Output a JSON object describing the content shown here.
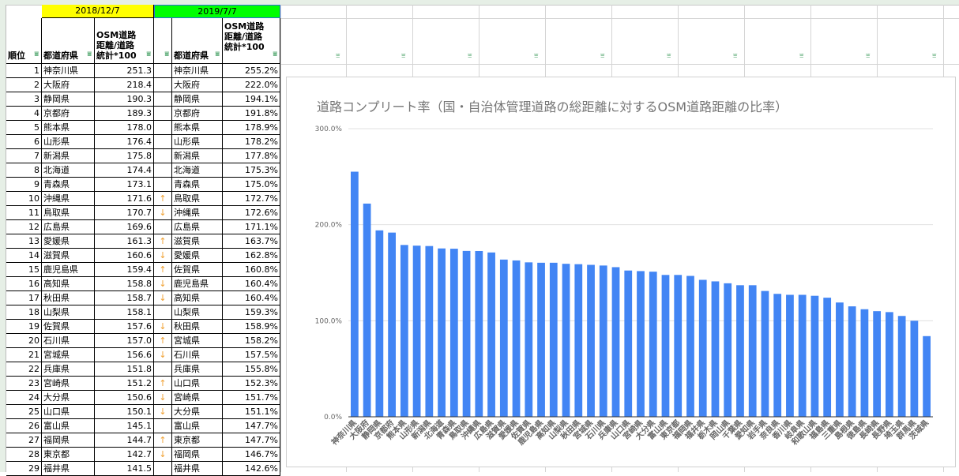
{
  "dates": {
    "d2018": "2018/12/7",
    "d2019": "2019/7/7"
  },
  "headers": {
    "rank": "順位",
    "pref": "都道府県",
    "ratio2018": "OSM道路距離/道路統計*100",
    "pref2019": "都道府県",
    "ratio2019": "OSM道路距離/道路統計*100"
  },
  "colors": {
    "d2018": "#ffff00",
    "d2019": "#00ff00",
    "bar": "#4285f4",
    "arrow": "#f0a030"
  },
  "rows": [
    [
      "1",
      "神奈川県",
      "251.3",
      "",
      "神奈川県",
      "255.2%"
    ],
    [
      "2",
      "大阪府",
      "218.4",
      "",
      "大阪府",
      "222.0%"
    ],
    [
      "3",
      "静岡県",
      "190.3",
      "",
      "静岡県",
      "194.1%"
    ],
    [
      "4",
      "京都府",
      "189.3",
      "",
      "京都府",
      "191.8%"
    ],
    [
      "5",
      "熊本県",
      "178.0",
      "",
      "熊本県",
      "178.9%"
    ],
    [
      "6",
      "山形県",
      "176.4",
      "",
      "山形県",
      "178.2%"
    ],
    [
      "7",
      "新潟県",
      "175.8",
      "",
      "新潟県",
      "177.8%"
    ],
    [
      "8",
      "北海道",
      "174.4",
      "",
      "北海道",
      "175.3%"
    ],
    [
      "9",
      "青森県",
      "173.1",
      "",
      "青森県",
      "175.0%"
    ],
    [
      "10",
      "沖縄県",
      "171.6",
      "↑",
      "鳥取県",
      "172.7%"
    ],
    [
      "11",
      "鳥取県",
      "170.7",
      "↓",
      "沖縄県",
      "172.6%"
    ],
    [
      "12",
      "広島県",
      "169.6",
      "",
      "広島県",
      "171.1%"
    ],
    [
      "13",
      "愛媛県",
      "161.3",
      "↑",
      "滋賀県",
      "163.7%"
    ],
    [
      "14",
      "滋賀県",
      "160.6",
      "↓",
      "愛媛県",
      "162.8%"
    ],
    [
      "15",
      "鹿児島県",
      "159.4",
      "↑",
      "佐賀県",
      "160.8%"
    ],
    [
      "16",
      "高知県",
      "158.8",
      "↓",
      "鹿児島県",
      "160.4%"
    ],
    [
      "17",
      "秋田県",
      "158.7",
      "↓",
      "高知県",
      "160.4%"
    ],
    [
      "18",
      "山梨県",
      "158.1",
      "",
      "山梨県",
      "159.3%"
    ],
    [
      "19",
      "佐賀県",
      "157.6",
      "↓",
      "秋田県",
      "158.9%"
    ],
    [
      "20",
      "石川県",
      "157.0",
      "↑",
      "宮城県",
      "158.2%"
    ],
    [
      "21",
      "宮城県",
      "156.6",
      "↓",
      "石川県",
      "157.5%"
    ],
    [
      "22",
      "兵庫県",
      "151.8",
      "",
      "兵庫県",
      "155.8%"
    ],
    [
      "23",
      "宮崎県",
      "151.2",
      "↑",
      "山口県",
      "152.3%"
    ],
    [
      "24",
      "大分県",
      "150.6",
      "↓",
      "宮崎県",
      "151.7%"
    ],
    [
      "25",
      "山口県",
      "150.1",
      "↓",
      "大分県",
      "151.1%"
    ],
    [
      "26",
      "富山県",
      "145.1",
      "",
      "富山県",
      "147.7%"
    ],
    [
      "27",
      "福岡県",
      "144.7",
      "↑",
      "東京都",
      "147.7%"
    ],
    [
      "28",
      "東京都",
      "142.7",
      "↓",
      "福岡県",
      "146.7%"
    ],
    [
      "29",
      "福井県",
      "141.5",
      "",
      "福井県",
      "142.6%"
    ]
  ],
  "chart_data": {
    "type": "bar",
    "title": "道路コンプリート率（国・自治体管理道路の総距離に対するOSM道路距離の比率）",
    "ylim": [
      0,
      300
    ],
    "yticks": [
      "0.0%",
      "100.0%",
      "200.0%",
      "300.0%"
    ],
    "grid": true,
    "categories": [
      "神奈川県",
      "大阪府",
      "静岡県",
      "京都府",
      "熊本県",
      "山形県",
      "新潟県",
      "北海道",
      "青森県",
      "鳥取県",
      "沖縄県",
      "広島県",
      "滋賀県",
      "愛媛県",
      "佐賀県",
      "鹿児島県",
      "高知県",
      "山梨県",
      "秋田県",
      "宮城県",
      "石川県",
      "兵庫県",
      "山口県",
      "宮崎県",
      "大分県",
      "富山県",
      "東京都",
      "福岡県",
      "福井県",
      "栃木県",
      "岡山県",
      "千葉県",
      "愛知県",
      "岩手県",
      "奈良県",
      "香川県",
      "岐阜県",
      "和歌山県",
      "福島県",
      "三重県",
      "島根県",
      "徳島県",
      "長崎県",
      "長野県",
      "埼玉県",
      "群馬県",
      "茨城県"
    ],
    "values": [
      255.2,
      222.0,
      194.1,
      191.8,
      178.9,
      178.2,
      177.8,
      175.3,
      175.0,
      172.7,
      172.6,
      171.1,
      163.7,
      162.8,
      160.8,
      160.4,
      160.4,
      159.3,
      158.9,
      158.2,
      157.5,
      155.8,
      152.3,
      151.7,
      151.1,
      147.7,
      147.7,
      146.7,
      142.6,
      141,
      139,
      137,
      137,
      131,
      128,
      127,
      127,
      126,
      124,
      119,
      115,
      112,
      110,
      109,
      105,
      100,
      84
    ]
  }
}
